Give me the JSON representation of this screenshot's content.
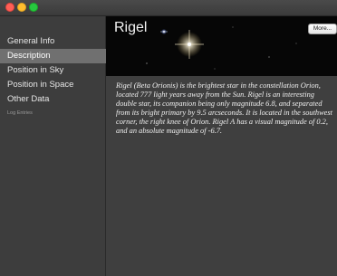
{
  "sidebar": {
    "items": [
      {
        "label": "General Info",
        "selected": false
      },
      {
        "label": "Description",
        "selected": true
      },
      {
        "label": "Position in Sky",
        "selected": false
      },
      {
        "label": "Position in Space",
        "selected": false
      },
      {
        "label": "Other Data",
        "selected": false
      },
      {
        "label": "Log Entries",
        "selected": false
      }
    ]
  },
  "header": {
    "title": "Rigel",
    "more_label": "More..."
  },
  "description": {
    "text": "Rigel (Beta Orionis) is the brightest star in the constellation Orion, located 777 light years away from the Sun. Rigel is an interesting double star, its companion being only magnitude 6.8, and separated from its bright primary by 9.5 arcseconds. It is located in the southwest corner, the right knee of Orion. Rigel A has a visual magnitude of 0.2, and an absolute magnitude of -6.7."
  }
}
